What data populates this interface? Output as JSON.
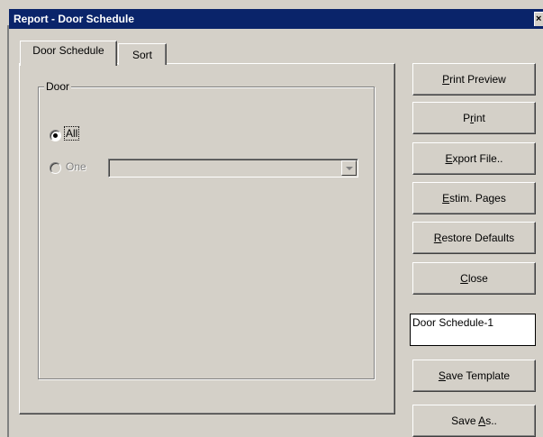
{
  "window": {
    "title": "Report  - Door Schedule",
    "close_glyph": "×"
  },
  "tabs": [
    {
      "label": "Door Schedule",
      "active": true
    },
    {
      "label": "Sort",
      "active": false
    }
  ],
  "door_group": {
    "label": "Door",
    "option_all": "All",
    "option_one": "One",
    "selected": "All",
    "one_combo_value": ""
  },
  "buttons": {
    "print_preview": {
      "mnemonic": "P",
      "rest": "rint Preview"
    },
    "print": {
      "before": "P",
      "mnemonic": "r",
      "rest": "int"
    },
    "export_file": {
      "mnemonic": "E",
      "rest": "xport File.."
    },
    "estim_pages": {
      "mnemonic": "E",
      "rest": "stim. Pages"
    },
    "restore_defaults": {
      "mnemonic": "R",
      "rest": "estore Defaults"
    },
    "close": {
      "mnemonic": "C",
      "rest": "lose"
    },
    "save_template": {
      "mnemonic": "S",
      "rest": "ave Template"
    },
    "save_as": {
      "before": "Save ",
      "mnemonic": "A",
      "rest": "s.."
    }
  },
  "template_name": "Door Schedule-1"
}
